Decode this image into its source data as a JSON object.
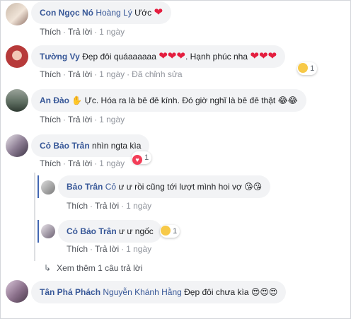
{
  "actions": {
    "like": "Thích",
    "reply": "Trả lời",
    "edited": "Đã chỉnh sửa"
  },
  "comments": [
    {
      "author": "Con Ngọc Nó",
      "mention": "Hoàng Lý",
      "text": "Ước",
      "emoji": "❤",
      "time": "1 ngày"
    },
    {
      "author": "Tường Vy",
      "text": "Đẹp đôi quáaaaaaa",
      "emoji_a": "❤❤❤",
      "text2": ". Hạnh phúc nha",
      "emoji_b": "❤❤❤",
      "time": "1 ngày",
      "reaction_count": "1"
    },
    {
      "author": "An Đào",
      "text": "✋ Ực. Hóa ra là bê đê kính. Đó giờ nghĩ là bê đê thật 😂😂",
      "time": "1 ngày"
    },
    {
      "author": "Cỏ Bảo Trân",
      "text": "nhìn ngta kìa",
      "time": "1 ngày",
      "reaction_count": "1"
    },
    {
      "author": "Tân Phá Phách",
      "mention": "Nguyễn Khánh Hằng",
      "text": "Đẹp đôi chưa kìa",
      "emoji": "😍😍😍"
    }
  ],
  "replies": [
    {
      "author": "Bảo Trân",
      "mention": "Cỏ",
      "text": "ư ư rồi cũng tới lượt mình hoi vợ",
      "emoji": "😘😘",
      "time": "1 ngày"
    },
    {
      "author": "Cỏ Bảo Trân",
      "text": "ư ư ngốc",
      "time": "1 ngày",
      "reaction_count": "1"
    }
  ],
  "more_replies": "Xem thêm 1 câu trả lời",
  "colors": {
    "link": "#385898",
    "bubble": "#f2f3f5",
    "heart": "#e41e3f"
  }
}
